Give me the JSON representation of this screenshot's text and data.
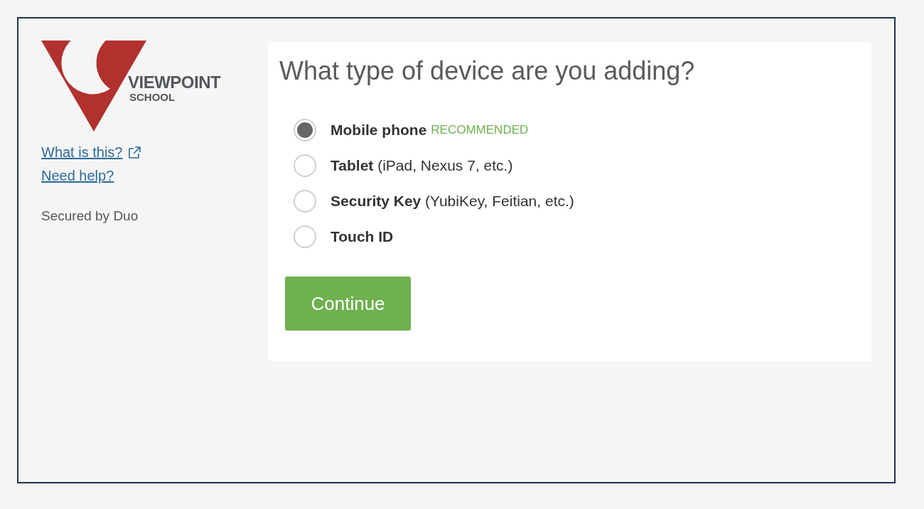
{
  "sidebar": {
    "logo": {
      "line_1": "VIEWPOINT",
      "line_2": "SCHOOL"
    },
    "links": [
      {
        "label": "What is this?",
        "external": true
      },
      {
        "label": "Need help?",
        "external": false
      }
    ],
    "footer": "Secured by Duo"
  },
  "card": {
    "title": "What type of device are you adding?",
    "options": [
      {
        "label": "**Mobile phone**",
        "badge": "RECOMMENDED",
        "selected": true
      },
      {
        "label": "**Tablet** (iPad, Nexus 7, etc.)",
        "selected": false
      },
      {
        "label": "**Security Key** (YubiKey, Feitian, etc.)",
        "selected": false
      },
      {
        "label": "**Touch ID**",
        "selected": false
      }
    ],
    "button": "Continue"
  }
}
